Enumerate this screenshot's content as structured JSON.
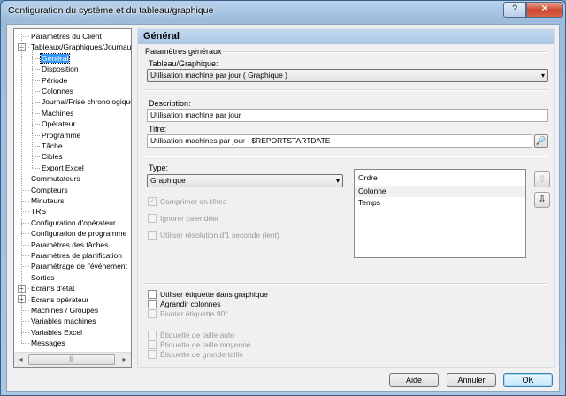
{
  "window": {
    "title": "Configuration du système et du tableau/graphique",
    "help_label": "?",
    "close_label": "✕"
  },
  "tree": {
    "items": [
      {
        "label": "Paramètres du Client",
        "level": 0
      },
      {
        "label": "Tableaux/Graphiques/Journaux",
        "level": 0,
        "expander": "−"
      },
      {
        "label": "Général",
        "level": 1,
        "selected": true
      },
      {
        "label": "Disposition",
        "level": 1
      },
      {
        "label": "Période",
        "level": 1
      },
      {
        "label": "Colonnes",
        "level": 1
      },
      {
        "label": "Journal/Frise chronologique",
        "level": 1
      },
      {
        "label": "Machines",
        "level": 1
      },
      {
        "label": "Opérateur",
        "level": 1
      },
      {
        "label": "Programme",
        "level": 1
      },
      {
        "label": "Tâche",
        "level": 1
      },
      {
        "label": "Cibles",
        "level": 1
      },
      {
        "label": "Export Excel",
        "level": 1
      },
      {
        "label": "Commutateurs",
        "level": 0
      },
      {
        "label": "Compteurs",
        "level": 0
      },
      {
        "label": "Minuteurs",
        "level": 0
      },
      {
        "label": "TRS",
        "level": 0
      },
      {
        "label": "Configuration d'opérateur",
        "level": 0
      },
      {
        "label": "Configuration de programme",
        "level": 0
      },
      {
        "label": "Paramètres des tâches",
        "level": 0
      },
      {
        "label": "Paramètres de planification",
        "level": 0
      },
      {
        "label": "Paramétrage de l'événement",
        "level": 0
      },
      {
        "label": "Sorties",
        "level": 0
      },
      {
        "label": "Écrans d'état",
        "level": 0,
        "expander": "+"
      },
      {
        "label": "Écrans opérateur",
        "level": 0,
        "expander": "+"
      },
      {
        "label": "Machines / Groupes",
        "level": 0
      },
      {
        "label": "Variables machines",
        "level": 0
      },
      {
        "label": "Variables Excel",
        "level": 0
      },
      {
        "label": "Messages",
        "level": 0
      }
    ],
    "scroll_left": "◂",
    "scroll_right": "▸",
    "scroll_grip": "|||"
  },
  "panel": {
    "header": "Général",
    "group_label": "Paramètres généraux",
    "chart_label": "Tableau/Graphique:",
    "chart_value": "Utilisation machine par jour  ( Graphique )",
    "description_label": "Description:",
    "description_value": "Utilisation machine par jour",
    "title_label": "Titre:",
    "title_value": "Utilisation machines par jour - $REPORTSTARTDATE",
    "type_label": "Type:",
    "type_value": "Graphique",
    "combo_arrow": "▾",
    "lookup_icon": "🔎",
    "options": [
      {
        "label": "Comprimer en-têtes",
        "checked": true,
        "enabled": false
      },
      {
        "label": "Ignorer calendrier",
        "checked": false,
        "enabled": false
      },
      {
        "label": "Utiliser résolution d'1 seconde (lent)",
        "checked": false,
        "enabled": false
      }
    ],
    "order": {
      "header": "Ordre",
      "items": [
        "Colonne",
        "Temps"
      ],
      "up_icon": "⇧",
      "down_icon": "⇩"
    },
    "label_options": [
      {
        "label": "Utiliser étiquette dans graphique",
        "checked": false,
        "enabled": true
      },
      {
        "label": "Agrandir colonnes",
        "checked": false,
        "enabled": true
      },
      {
        "label": "Pivoter étiquette 90°",
        "checked": false,
        "enabled": false
      }
    ],
    "size_options": [
      {
        "label": "Étiquette de taille auto",
        "checked": false,
        "enabled": false
      },
      {
        "label": "Étiquette de taille moyenne",
        "checked": false,
        "enabled": false
      },
      {
        "label": "Étiquette de grande taille",
        "checked": false,
        "enabled": false
      }
    ]
  },
  "buttons": {
    "help": "Aide",
    "cancel": "Annuler",
    "ok": "OK"
  }
}
